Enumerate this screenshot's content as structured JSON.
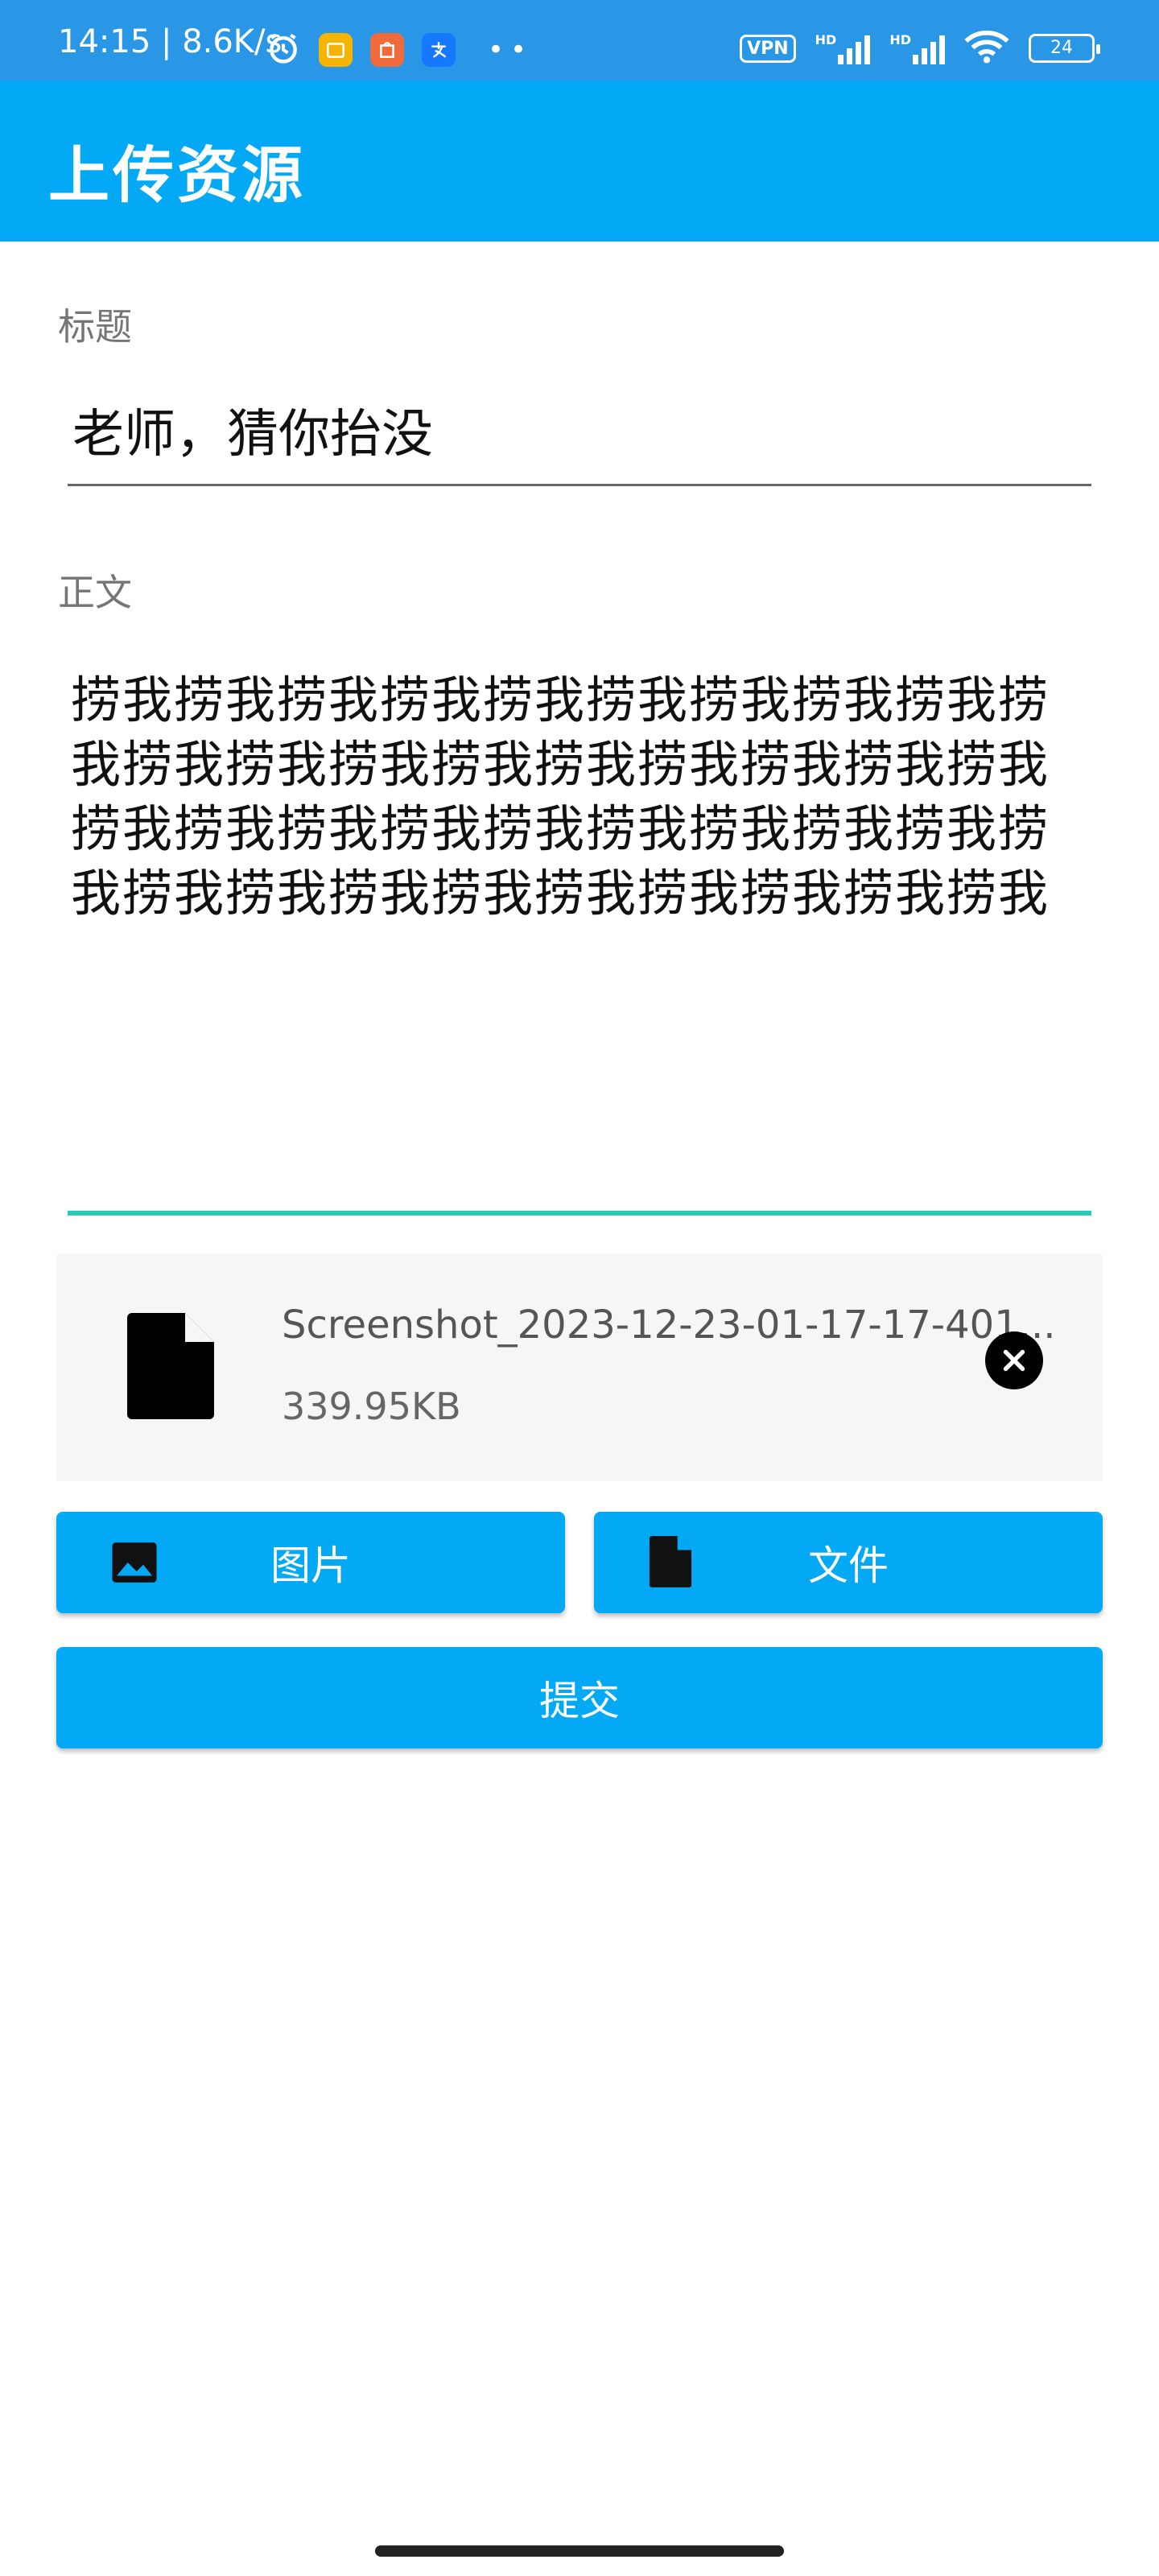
{
  "status_bar": {
    "time": "14:15",
    "speed": "8.6K/s",
    "vpn": "VPN",
    "hd1": "HD",
    "hd2": "HD",
    "battery": "24"
  },
  "app_bar": {
    "title": "上传资源"
  },
  "form": {
    "title_label": "标题",
    "title_value": "老师，猜你抬没",
    "body_label": "正文",
    "body_value": "捞我捞我捞我捞我捞我捞我捞我捞我捞我捞我捞我捞我捞我捞我捞我捞我捞我捞我捞我捞我捞我捞我捞我捞我捞我捞我捞我捞我捞我捞我捞我捞我捞我捞我捞我捞我捞我捞我"
  },
  "attachment": {
    "file_name": "Screenshot_2023-12-23-01-17-17-401...",
    "file_size": "339.95KB",
    "icon": "file-icon",
    "remove_icon": "close-icon"
  },
  "buttons": {
    "image": "图片",
    "file": "文件",
    "submit": "提交"
  },
  "colors": {
    "status_bar": "#2a97e6",
    "primary": "#03a9f4",
    "focus_underline": "#2dcbb5",
    "card_bg": "#f6f6f6"
  }
}
